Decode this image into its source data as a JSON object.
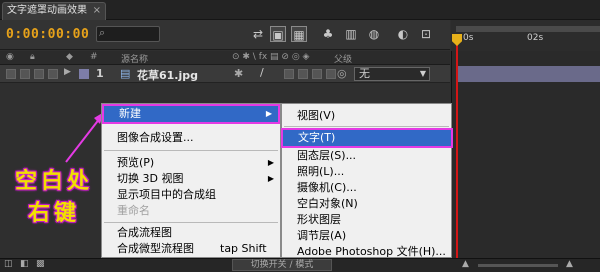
{
  "window": {
    "tab_title": "文字遮罩动画效果",
    "tab_close": "×"
  },
  "toolbar": {
    "timecode": "0:00:00:00",
    "search_glyph": "⌕"
  },
  "columns": {
    "source_name": "源名称",
    "parent": "父级"
  },
  "layer": {
    "number": "1",
    "name": "花草61.jpg",
    "parent_value": "无"
  },
  "timeline": {
    "ruler_start": "0s",
    "ruler_02": "02s"
  },
  "status": {
    "mode_button": "切换开关 / 模式"
  },
  "context_menu": {
    "items": [
      {
        "label": "新建",
        "selected": true,
        "submenu": true
      },
      {
        "label": "图像合成设置..."
      },
      {
        "label": "预览(P)",
        "submenu": true
      },
      {
        "label": "切换 3D 视图",
        "submenu": true
      },
      {
        "label": "显示项目中的合成组"
      },
      {
        "label": "重命名",
        "disabled": true
      },
      {
        "label": "合成流程图"
      },
      {
        "label": "合成微型流程图",
        "shortcut": "tap Shift"
      }
    ]
  },
  "submenu": {
    "items": [
      {
        "label": "视图(V)"
      },
      {
        "label": "文字(T)",
        "selected": true
      },
      {
        "label": "固态层(S)..."
      },
      {
        "label": "照明(L)..."
      },
      {
        "label": "摄像机(C)..."
      },
      {
        "label": "空白对象(N)"
      },
      {
        "label": "形状图层"
      },
      {
        "label": "调节层(A)"
      },
      {
        "label": "Adobe Photoshop 文件(H)..."
      }
    ]
  },
  "annotation": {
    "line1": "空白处",
    "line2": "右键"
  },
  "colors": {
    "highlight": "#e43ae4",
    "selection": "#3169c6",
    "timecode": "#e7a21a",
    "annotation": "#f1e000"
  }
}
